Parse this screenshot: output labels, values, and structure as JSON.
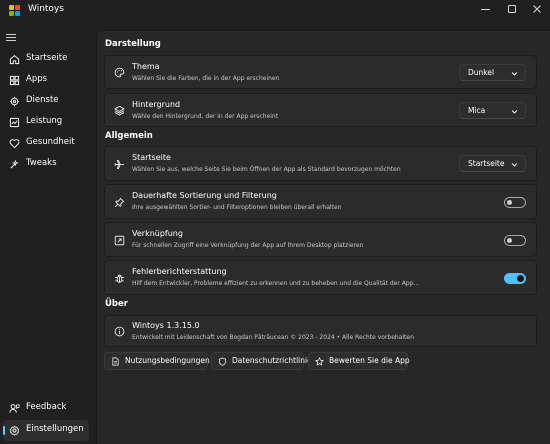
{
  "window": {
    "title": "Wintoys",
    "logo_colors": [
      "#ffb900",
      "#f25022",
      "#7fba00",
      "#00a4ef"
    ],
    "controls": [
      "minimize-icon",
      "maximize-icon",
      "close-icon"
    ]
  },
  "theme": {
    "accent": "#4cc2ff",
    "selection_bar": "#60cdff"
  },
  "sidebar": {
    "items": [
      {
        "label": "Startseite",
        "icon": "home-icon"
      },
      {
        "label": "Apps",
        "icon": "apps-icon"
      },
      {
        "label": "Dienste",
        "icon": "services-icon"
      },
      {
        "label": "Leistung",
        "icon": "performance-icon"
      },
      {
        "label": "Gesundheit",
        "icon": "health-icon"
      },
      {
        "label": "Tweaks",
        "icon": "tweaks-icon"
      }
    ],
    "footer_items": [
      {
        "label": "Feedback",
        "icon": "feedback-icon"
      },
      {
        "label": "Einstellungen",
        "icon": "settings-icon",
        "selected": true
      }
    ]
  },
  "settings": {
    "sections": {
      "appearance": "Darstellung",
      "general": "Allgemein",
      "about": "Über"
    },
    "theme_card": {
      "title": "Thema",
      "description": "Wählen Sie die Farben, die in der App erscheinen",
      "value": "Dunkel"
    },
    "background_card": {
      "title": "Hintergrund",
      "description": "Wähle den Hintergrund, der in der App erscheint",
      "value": "Mica"
    },
    "startpage_card": {
      "title": "Startseite",
      "description": "Wählen Sie aus, welche Seite Sie beim Öffnen der App als Standard bevorzugen möchten",
      "value": "Startseite"
    },
    "persistent_sort_card": {
      "title": "Dauerhafte Sortierung und Filterung",
      "description": "Ihre ausgewählten Sortier- und Filteroptionen bleiben überall erhalten",
      "enabled": false
    },
    "shortcut_card": {
      "title": "Verknüpfung",
      "description": "Für schnellen Zugriff eine Verknüpfung der App auf Ihrem Desktop platzieren",
      "enabled": false
    },
    "error_report_card": {
      "title": "Fehlerberichterstattung",
      "description": "Hilf dem Entwickler, Probleme effizient zu erkennen und zu beheben und die Qualität der App...",
      "enabled": true
    },
    "about_card": {
      "title": "Wintoys 1.3.15.0",
      "description": "Entwickelt mit Leidenschaft von Bogdan Pătrăucean © 2023 - 2024 • Alle Rechte vorbehalten"
    },
    "links": {
      "terms": "Nutzungsbedingungen",
      "privacy": "Datenschutzrichtlinie",
      "rate": "Bewerten Sie die App"
    }
  }
}
